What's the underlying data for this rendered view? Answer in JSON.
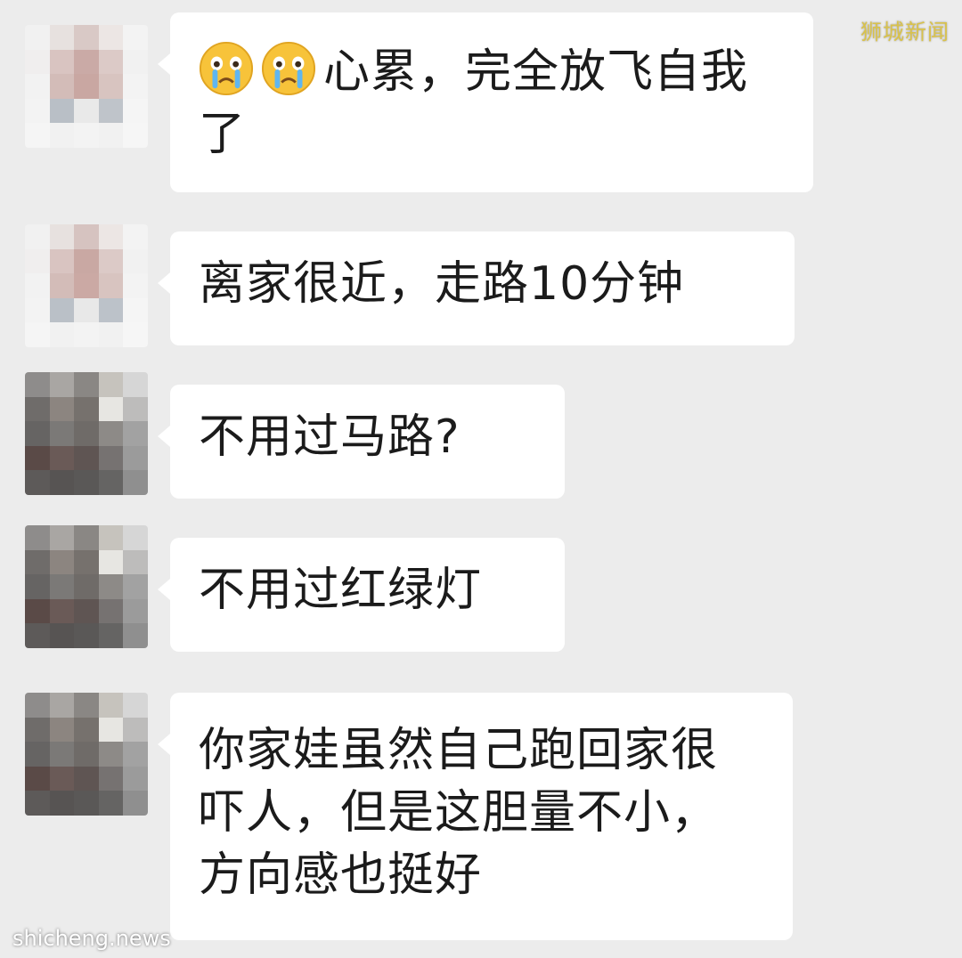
{
  "watermarks": {
    "top_right": "狮城新闻",
    "bottom_left": "shicheng.news"
  },
  "messages": [
    {
      "avatar": "avatar-light",
      "emojis": [
        "crying-face-emoji",
        "crying-face-emoji"
      ],
      "text": "心累，完全放飞自我了"
    },
    {
      "avatar": "avatar-light",
      "emojis": [],
      "text": "离家很近，走路10分钟"
    },
    {
      "avatar": "avatar-dark",
      "emojis": [],
      "text": "不用过马路?"
    },
    {
      "avatar": "avatar-dark",
      "emojis": [],
      "text": "不用过红绿灯"
    },
    {
      "avatar": "avatar-dark",
      "emojis": [],
      "text": "你家娃虽然自己跑回家很吓人，但是这胆量不小，方向感也挺好"
    }
  ],
  "colors": {
    "background": "#ececec",
    "bubble": "#ffffff",
    "text": "#1b1b1b",
    "watermark_top": "#d9c24b"
  }
}
